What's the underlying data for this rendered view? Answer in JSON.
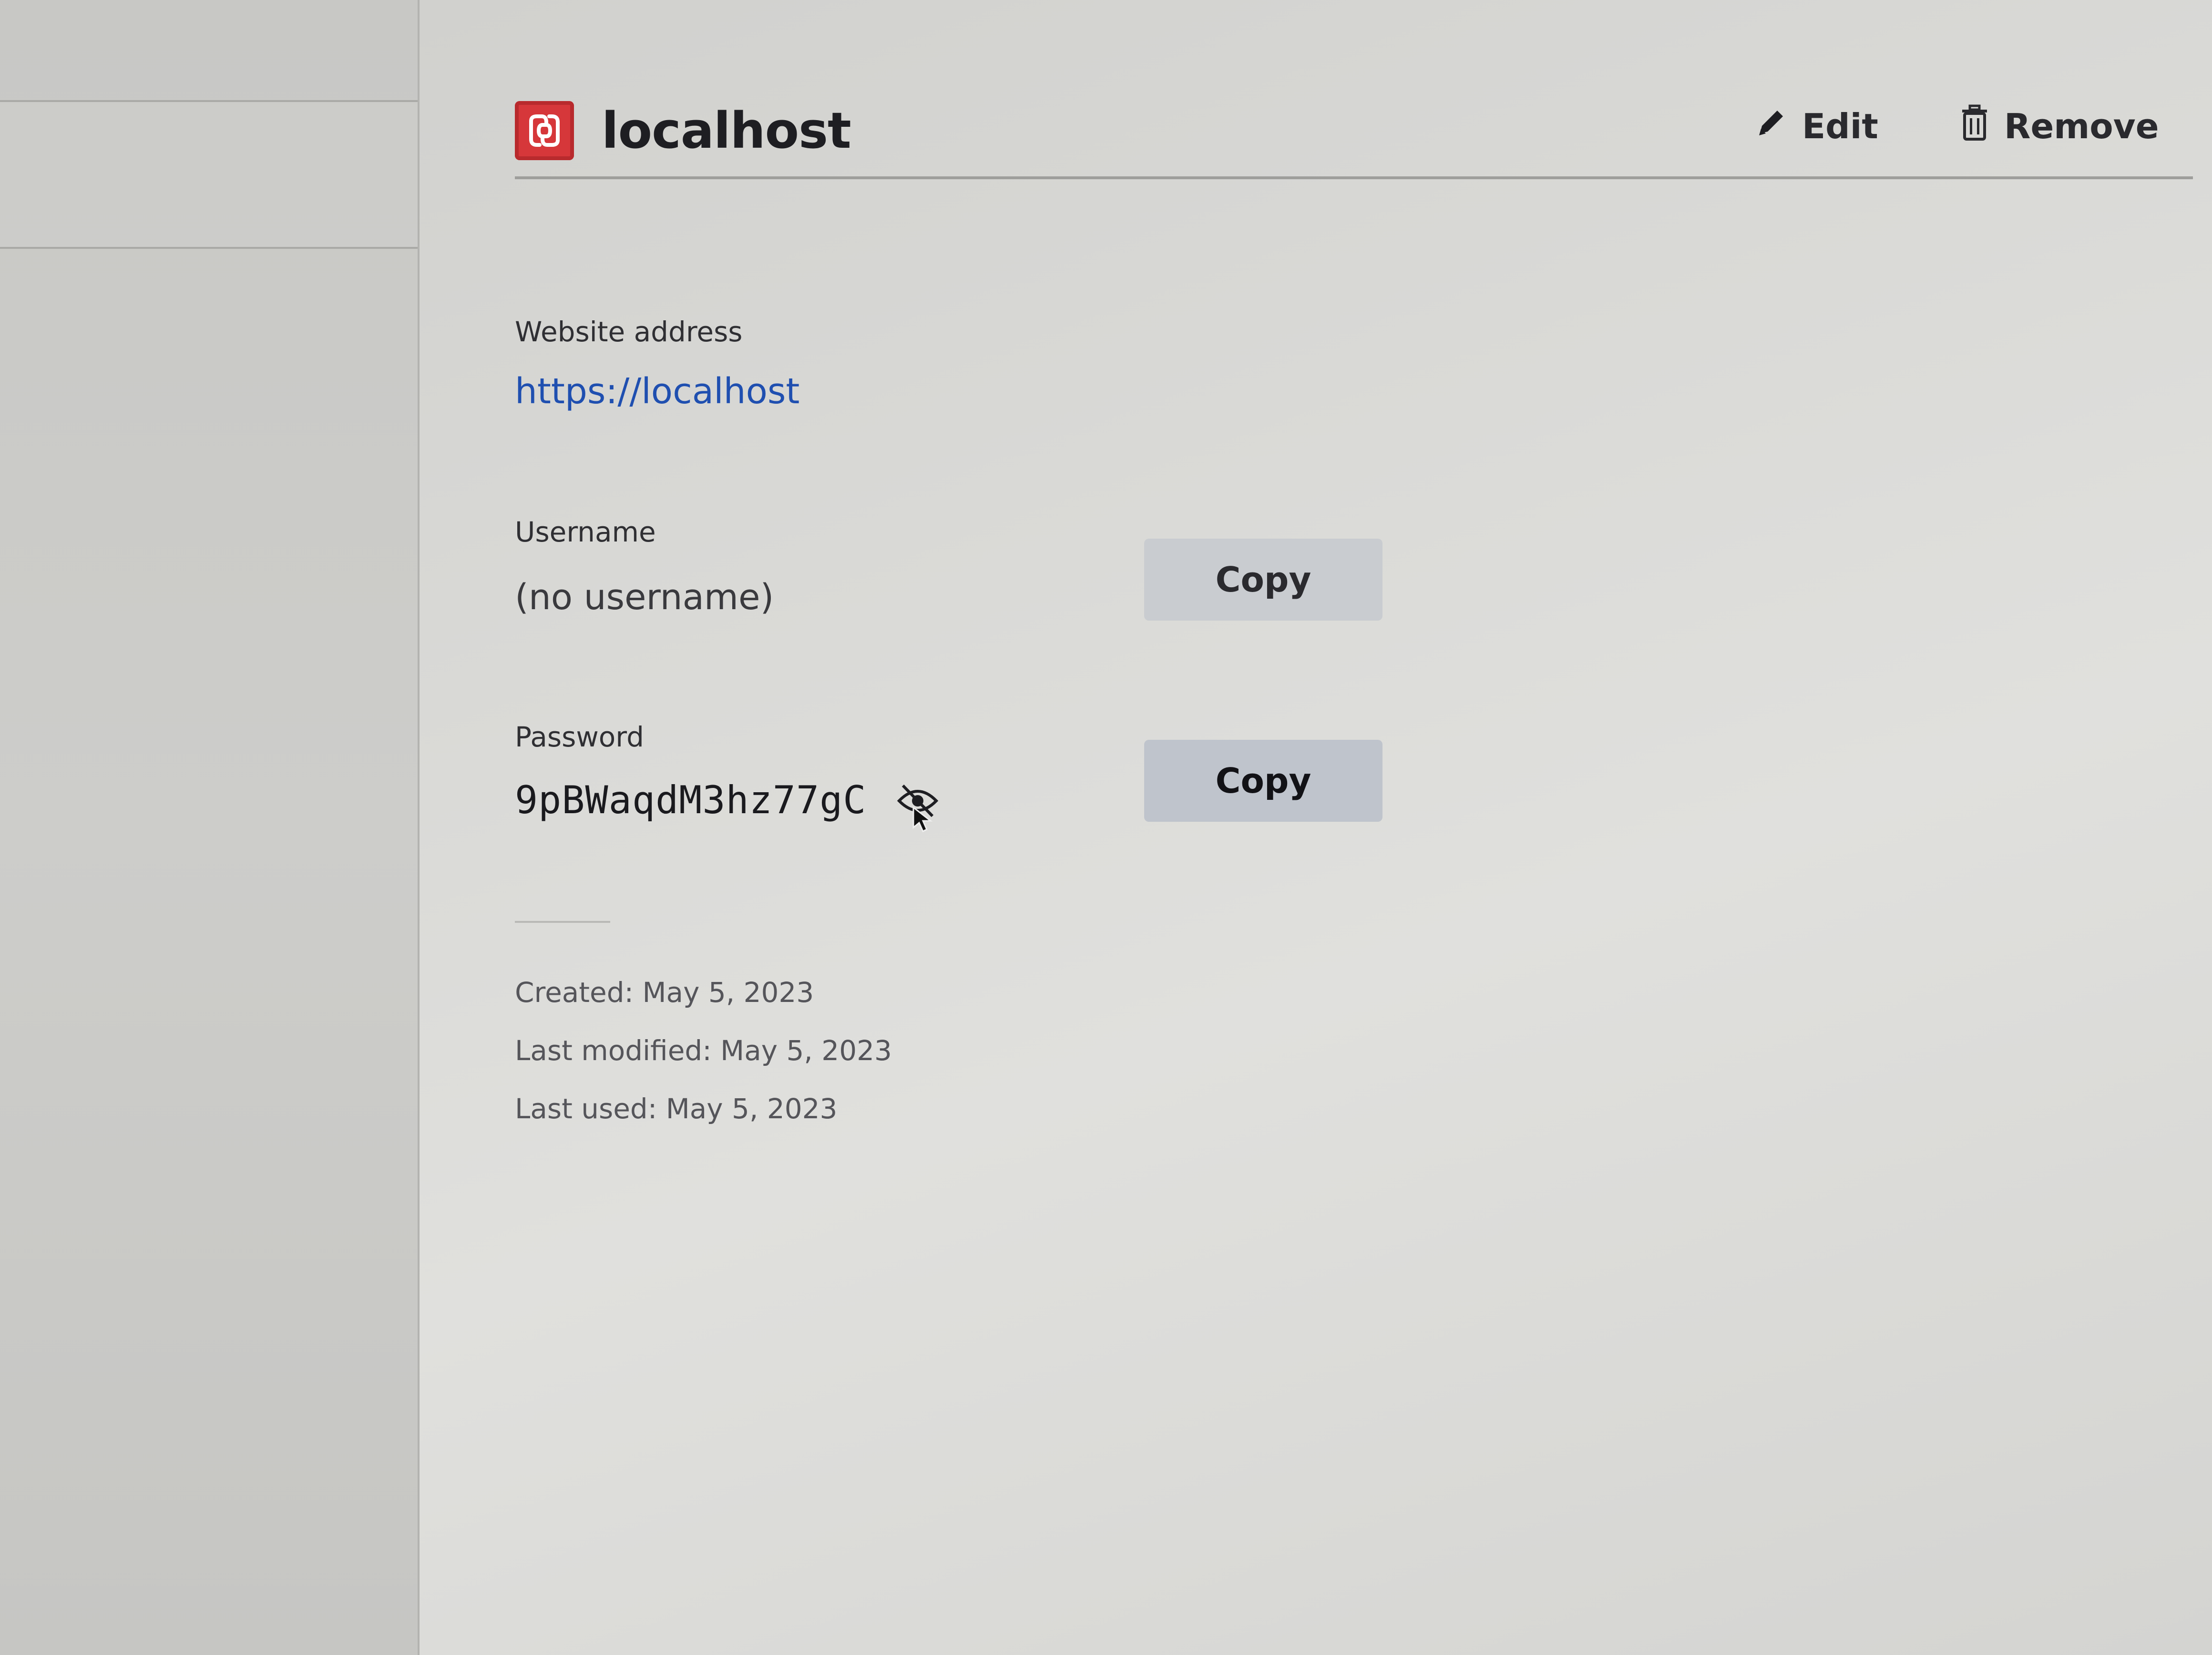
{
  "colors": {
    "accent_link": "#1f4fb0",
    "brand_icon_red": "#d6373a",
    "button_bg": "#c9ccd0"
  },
  "login": {
    "title": "localhost",
    "icon": "xampp-logo-icon",
    "actions": {
      "edit_label": "Edit",
      "edit_icon": "pencil-icon",
      "remove_label": "Remove",
      "remove_icon": "trash-icon"
    },
    "website": {
      "label": "Website address",
      "value": "https://localhost"
    },
    "username": {
      "label": "Username",
      "value": "(no username)",
      "copy_label": "Copy"
    },
    "password": {
      "label": "Password",
      "value": "9pBWaqdM3hz77gC",
      "reveal_icon": "eye-slash-icon",
      "copy_label": "Copy"
    },
    "meta": {
      "created": "Created: May 5, 2023",
      "modified": "Last modified: May 5, 2023",
      "used": "Last used: May 5, 2023"
    }
  }
}
